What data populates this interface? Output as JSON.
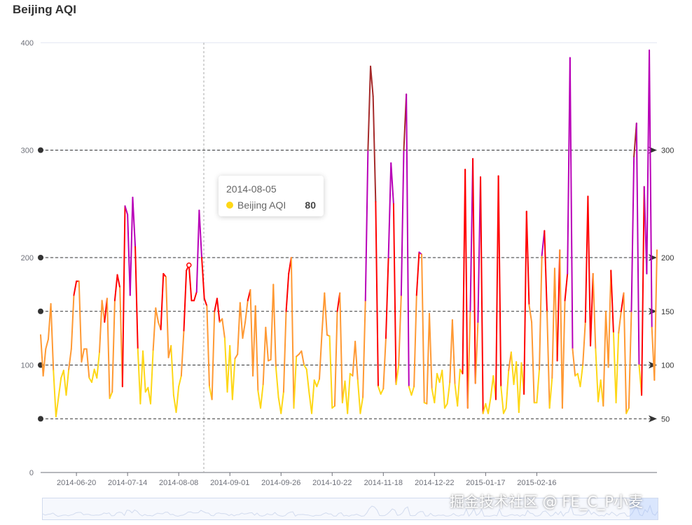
{
  "title": "Beijing AQI",
  "tooltip": {
    "date": "2014-08-05",
    "series": "Beijing AQI",
    "value": "80"
  },
  "watermark": "掘金技术社区 @ FE_C_P小麦",
  "chart_data": {
    "type": "line",
    "title": "Beijing AQI",
    "xlabel": "",
    "ylabel": "",
    "ylim": [
      0,
      400
    ],
    "ytick_labels": [
      "0",
      "100",
      "200",
      "300",
      "400"
    ],
    "xtick_labels": [
      "2014-06-20",
      "2014-07-14",
      "2014-08-08",
      "2014-09-01",
      "2014-09-26",
      "2014-10-22",
      "2014-11-18",
      "2014-12-22",
      "2015-01-17",
      "2015-02-16"
    ],
    "xtick_positions": [
      14,
      34,
      54,
      74,
      94,
      114,
      134,
      154,
      174,
      194
    ],
    "visual_map": [
      {
        "gt": 0,
        "lte": 50,
        "color": "#fed716"
      },
      {
        "gt": 50,
        "lte": 100,
        "color": "#fed716"
      },
      {
        "gt": 100,
        "lte": 150,
        "color": "#ff9933"
      },
      {
        "gt": 150,
        "lte": 200,
        "color": "#ff0000"
      },
      {
        "gt": 200,
        "lte": 300,
        "color": "#b800b8"
      },
      {
        "gt": 300,
        "color": "#a52a2a"
      }
    ],
    "mark_lines": [
      50,
      100,
      150,
      200,
      300
    ],
    "series": [
      {
        "name": "Beijing AQI",
        "values": [
          128,
          90,
          115,
          124,
          157,
          95,
          52,
          70,
          88,
          95,
          72,
          96,
          115,
          165,
          178,
          178,
          103,
          115,
          115,
          88,
          84,
          96,
          88,
          112,
          160,
          140,
          162,
          69,
          75,
          160,
          184,
          172,
          80,
          248,
          240,
          165,
          256,
          210,
          115,
          64,
          113,
          75,
          79,
          64,
          114,
          153,
          140,
          133,
          185,
          182,
          107,
          118,
          72,
          56,
          80,
          90,
          132,
          188,
          193,
          160,
          160,
          168,
          244,
          200,
          162,
          155,
          80,
          68,
          150,
          162,
          140,
          143,
          125,
          75,
          118,
          68,
          106,
          110,
          158,
          125,
          140,
          160,
          170,
          90,
          155,
          76,
          60,
          82,
          135,
          104,
          105,
          175,
          98,
          70,
          55,
          75,
          150,
          185,
          200,
          60,
          108,
          110,
          113,
          100,
          96,
          74,
          55,
          86,
          80,
          87,
          130,
          167,
          128,
          127,
          60,
          62,
          150,
          167,
          65,
          85,
          55,
          92,
          90,
          122,
          86,
          55,
          70,
          160,
          300,
          378,
          350,
          252,
          80,
          73,
          78,
          125,
          200,
          288,
          250,
          82,
          100,
          165,
          300,
          352,
          80,
          72,
          80,
          165,
          205,
          203,
          65,
          64,
          148,
          78,
          65,
          92,
          84,
          95,
          60,
          64,
          84,
          142,
          82,
          62,
          96,
          92,
          282,
          60,
          150,
          292,
          83,
          140,
          275,
          55,
          64,
          55,
          70,
          90,
          68,
          276,
          80,
          55,
          60,
          95,
          112,
          82,
          103,
          56,
          102,
          73,
          243,
          156,
          140,
          65,
          65,
          96,
          202,
          225,
          150,
          60,
          88,
          190,
          104,
          207,
          60,
          160,
          185,
          386,
          115,
          90,
          92,
          80,
          100,
          140,
          257,
          118,
          185,
          115,
          66,
          86,
          62,
          150,
          98,
          188,
          130,
          65,
          130,
          150,
          167,
          55,
          60,
          150,
          294,
          325,
          100,
          72,
          266,
          185,
          393,
          135,
          86,
          207
        ]
      }
    ]
  }
}
